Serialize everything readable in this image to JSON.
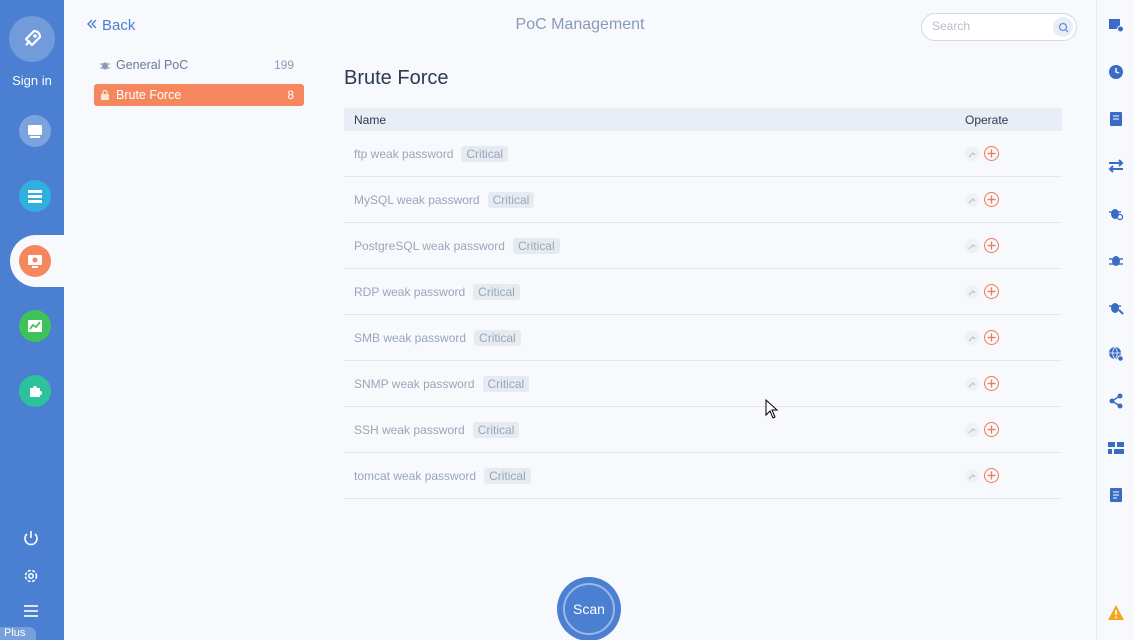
{
  "sidebar": {
    "signin_label": "Sign in",
    "plus_label": "Plus"
  },
  "header": {
    "back_label": "Back",
    "title": "PoC Management",
    "search_placeholder": "Search"
  },
  "categories": [
    {
      "label": "General PoC",
      "count": "199",
      "active": false
    },
    {
      "label": "Brute Force",
      "count": "8",
      "active": true
    }
  ],
  "main": {
    "section_title": "Brute Force",
    "columns": {
      "name": "Name",
      "operate": "Operate"
    },
    "rows": [
      {
        "name": "ftp weak password",
        "severity": "Critical"
      },
      {
        "name": "MySQL weak password",
        "severity": "Critical"
      },
      {
        "name": "PostgreSQL weak password",
        "severity": "Critical"
      },
      {
        "name": "RDP weak password",
        "severity": "Critical"
      },
      {
        "name": "SMB weak password",
        "severity": "Critical"
      },
      {
        "name": "SNMP weak password",
        "severity": "Critical"
      },
      {
        "name": "SSH weak password",
        "severity": "Critical"
      },
      {
        "name": "tomcat weak password",
        "severity": "Critical"
      }
    ]
  },
  "scan_label": "Scan",
  "colors": {
    "sidebar": "#4a7fd1",
    "accent": "#f4875d",
    "critical_badge_bg": "#e6ebf2"
  },
  "icons": {
    "left_nav": [
      "rocket-icon",
      "monitor-icon",
      "list-icon",
      "bug-screen-icon",
      "chart-icon",
      "puzzle-icon"
    ],
    "left_bottom": [
      "power-icon",
      "gear-icon",
      "menu-icon"
    ],
    "right_bar": [
      "add-task-icon",
      "clock-icon",
      "report-icon",
      "transfer-icon",
      "bug-search-icon",
      "bug-icon",
      "bug-tools-icon",
      "globe-gear-icon",
      "share-icon",
      "grid-icon",
      "book-icon",
      "warning-icon"
    ]
  }
}
